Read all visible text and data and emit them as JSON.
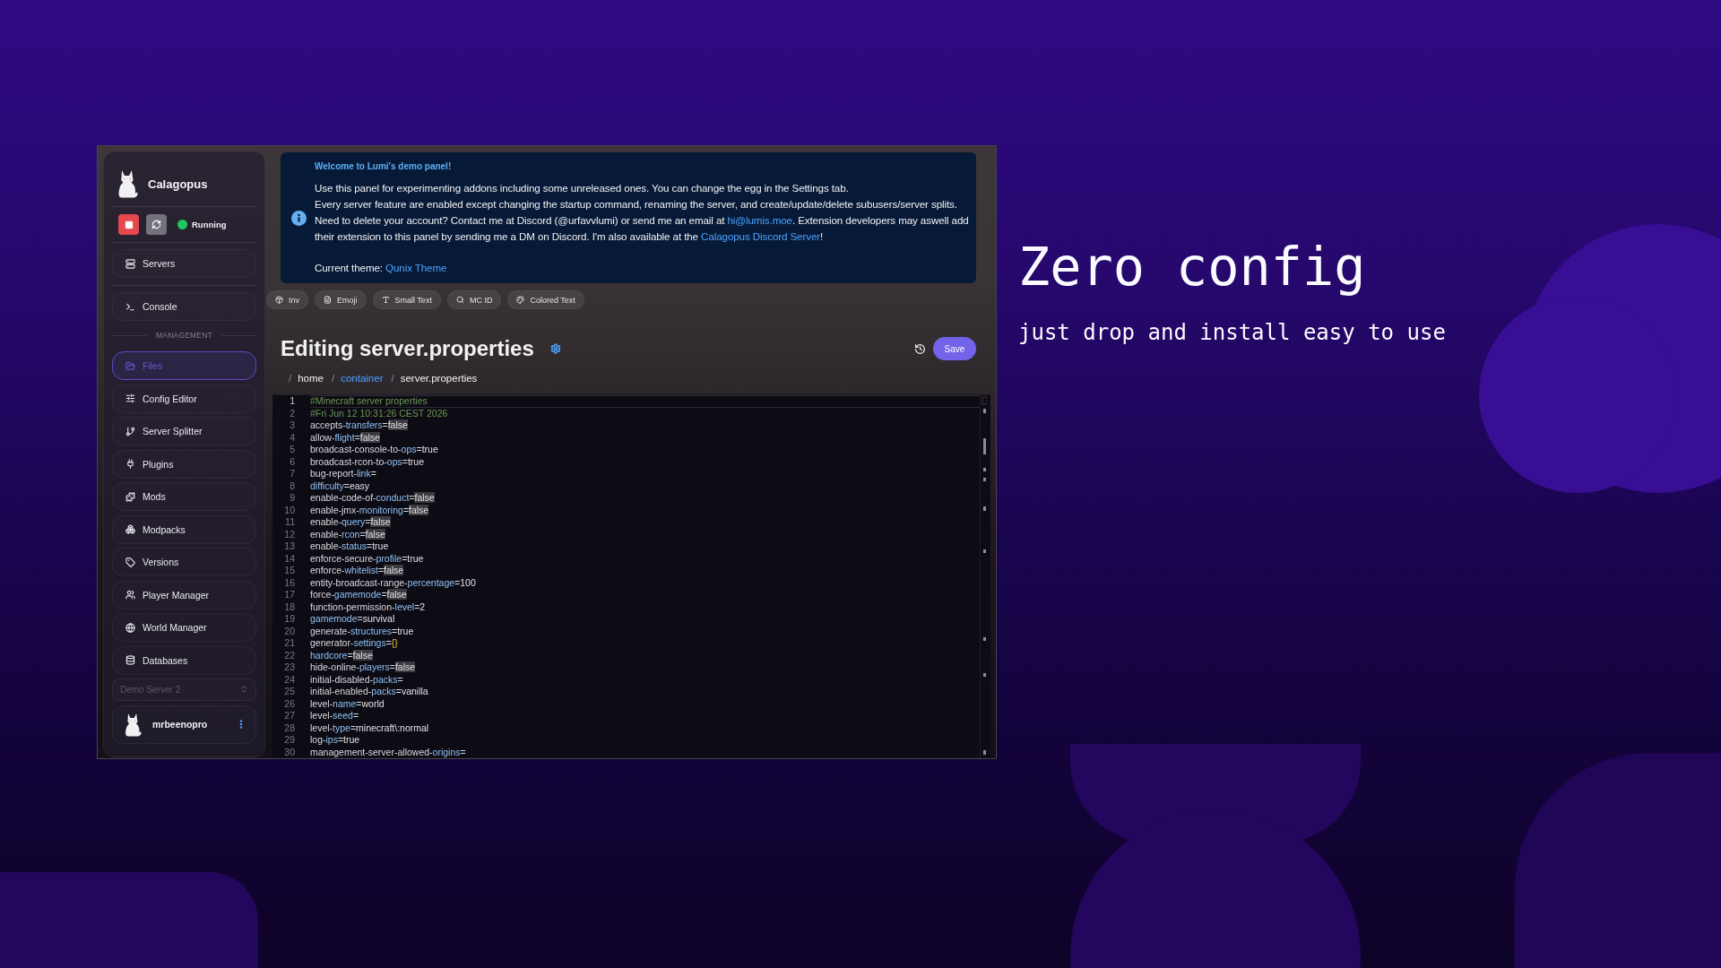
{
  "sidebar": {
    "brand": "Calagopus",
    "status": "Running",
    "nav_groups": [
      {
        "items": [
          {
            "label": "Servers",
            "selected": false
          }
        ]
      },
      {
        "items": [
          {
            "label": "Console",
            "selected": false
          }
        ]
      },
      {
        "heading": "MANAGEMENT",
        "items": [
          {
            "label": "Files",
            "selected": true
          },
          {
            "label": "Config Editor",
            "selected": false
          },
          {
            "label": "Server Splitter",
            "selected": false
          },
          {
            "label": "Plugins",
            "selected": false
          },
          {
            "label": "Mods",
            "selected": false
          },
          {
            "label": "Modpacks",
            "selected": false
          },
          {
            "label": "Versions",
            "selected": false
          },
          {
            "label": "Player Manager",
            "selected": false
          },
          {
            "label": "World Manager",
            "selected": false
          },
          {
            "label": "Databases",
            "selected": false
          }
        ]
      }
    ],
    "server_select": {
      "value": "Demo Server 2",
      "disabled": true
    },
    "user": {
      "name": "mrbeenopro"
    }
  },
  "notice": {
    "title": "Welcome to Lumi's demo panel!",
    "paragraphs": [
      {
        "segments": [
          {
            "kind": "text",
            "text": "Use this panel for experimenting addons including some unreleased ones. You can change the egg in the Settings tab."
          }
        ]
      },
      {
        "segments": [
          {
            "kind": "text",
            "text": "Every server feature are enabled except changing the startup command, renaming the server, and create/update/delete subusers/server splits."
          }
        ]
      },
      {
        "segments": [
          {
            "kind": "text",
            "text": "Need to delete your account? Contact me at Discord (@urfavvlumi) or send me an email at "
          },
          {
            "kind": "link",
            "text": "hi@lumis.moe"
          },
          {
            "kind": "text",
            "text": ". Extension developers may aswell add their extension to this panel by sending me a DM on Discord. I'm also available at the "
          },
          {
            "kind": "link",
            "text": "Calagopus Discord Server"
          },
          {
            "kind": "text",
            "text": "!"
          }
        ]
      }
    ],
    "theme_line": {
      "segments": [
        {
          "kind": "text",
          "text": "Current theme: "
        },
        {
          "kind": "link",
          "text": "Qunix Theme"
        }
      ]
    }
  },
  "toolbar": {
    "items": [
      {
        "label": "Inv"
      },
      {
        "label": "Emoji"
      },
      {
        "label": "Small Text"
      },
      {
        "label": "MC ID"
      },
      {
        "label": "Colored Text"
      }
    ]
  },
  "editor": {
    "title": "Editing server.properties",
    "save_label": "Save",
    "breadcrumb": [
      {
        "separator": "/",
        "label": "home",
        "link": false
      },
      {
        "separator": "/",
        "label": "container",
        "link": true
      },
      {
        "separator": "/",
        "label": "server.properties",
        "link": false
      }
    ],
    "lines": [
      {
        "number": "1",
        "kind": "comment",
        "text": "#Minecraft server properties",
        "highlighted": false,
        "active": true
      },
      {
        "number": "2",
        "kind": "comment",
        "text": "#Fri Jun 12 10:31:26 CEST 2026",
        "highlighted": false,
        "active": false
      },
      {
        "number": "3",
        "kind": "property",
        "key_head": "accepts-",
        "key_tail": "transfers",
        "operator": "=",
        "value": {
          "kind": "word",
          "text": "false"
        },
        "highlighted": true,
        "active": false
      },
      {
        "number": "4",
        "kind": "property",
        "key_head": "allow-",
        "key_tail": "flight",
        "operator": "=",
        "value": {
          "kind": "word",
          "text": "false"
        },
        "highlighted": true,
        "active": false
      },
      {
        "number": "5",
        "kind": "property",
        "key_head": "broadcast-console-to-",
        "key_tail": "ops",
        "operator": "=",
        "value": {
          "kind": "word",
          "text": "true"
        },
        "highlighted": false,
        "active": false
      },
      {
        "number": "6",
        "kind": "property",
        "key_head": "broadcast-rcon-to-",
        "key_tail": "ops",
        "operator": "=",
        "value": {
          "kind": "word",
          "text": "true"
        },
        "highlighted": false,
        "active": false
      },
      {
        "number": "7",
        "kind": "property",
        "key_head": "bug-report-",
        "key_tail": "link",
        "operator": "=",
        "highlighted": false,
        "active": false
      },
      {
        "number": "8",
        "kind": "property",
        "key_tail": "difficulty",
        "operator": "=",
        "value": {
          "kind": "word",
          "text": "easy"
        },
        "highlighted": false,
        "active": false
      },
      {
        "number": "9",
        "kind": "property",
        "key_head": "enable-code-of-",
        "key_tail": "conduct",
        "operator": "=",
        "value": {
          "kind": "word",
          "text": "false"
        },
        "highlighted": true,
        "active": false
      },
      {
        "number": "10",
        "kind": "property",
        "key_head": "enable-jmx-",
        "key_tail": "monitoring",
        "operator": "=",
        "value": {
          "kind": "word",
          "text": "false"
        },
        "highlighted": true,
        "active": false
      },
      {
        "number": "11",
        "kind": "property",
        "key_head": "enable-",
        "key_tail": "query",
        "operator": "=",
        "value": {
          "kind": "word",
          "text": "false"
        },
        "highlighted": true,
        "active": false
      },
      {
        "number": "12",
        "kind": "property",
        "key_head": "enable-",
        "key_tail": "rcon",
        "operator": "=",
        "value": {
          "kind": "word",
          "text": "false"
        },
        "highlighted": true,
        "active": false
      },
      {
        "number": "13",
        "kind": "property",
        "key_head": "enable-",
        "key_tail": "status",
        "operator": "=",
        "value": {
          "kind": "word",
          "text": "true"
        },
        "highlighted": false,
        "active": false
      },
      {
        "number": "14",
        "kind": "property",
        "key_head": "enforce-secure-",
        "key_tail": "profile",
        "operator": "=",
        "value": {
          "kind": "word",
          "text": "true"
        },
        "highlighted": false,
        "active": false
      },
      {
        "number": "15",
        "kind": "property",
        "key_head": "enforce-",
        "key_tail": "whitelist",
        "operator": "=",
        "value": {
          "kind": "word",
          "text": "false"
        },
        "highlighted": true,
        "active": false
      },
      {
        "number": "16",
        "kind": "property",
        "key_head": "entity-broadcast-range-",
        "key_tail": "percentage",
        "operator": "=",
        "value": {
          "kind": "word",
          "text": "100"
        },
        "highlighted": false,
        "active": false
      },
      {
        "number": "17",
        "kind": "property",
        "key_head": "force-",
        "key_tail": "gamemode",
        "operator": "=",
        "value": {
          "kind": "word",
          "text": "false"
        },
        "highlighted": true,
        "active": false
      },
      {
        "number": "18",
        "kind": "property",
        "key_head": "function-permission-",
        "key_tail": "level",
        "operator": "=",
        "value": {
          "kind": "word",
          "text": "2"
        },
        "highlighted": false,
        "active": false
      },
      {
        "number": "19",
        "kind": "property",
        "key_tail": "gamemode",
        "operator": "=",
        "value": {
          "kind": "word",
          "text": "survival"
        },
        "highlighted": false,
        "active": false
      },
      {
        "number": "20",
        "kind": "property",
        "key_head": "generate-",
        "key_tail": "structures",
        "operator": "=",
        "value": {
          "kind": "word",
          "text": "true"
        },
        "highlighted": false,
        "active": false
      },
      {
        "number": "21",
        "kind": "property",
        "key_head": "generator-",
        "key_tail": "settings",
        "operator": "=",
        "value": {
          "kind": "brace",
          "text": "{}"
        },
        "highlighted": false,
        "active": false
      },
      {
        "number": "22",
        "kind": "property",
        "key_tail": "hardcore",
        "operator": "=",
        "value": {
          "kind": "word",
          "text": "false"
        },
        "highlighted": true,
        "active": false
      },
      {
        "number": "23",
        "kind": "property",
        "key_head": "hide-online-",
        "key_tail": "players",
        "operator": "=",
        "value": {
          "kind": "word",
          "text": "false"
        },
        "highlighted": true,
        "active": false
      },
      {
        "number": "24",
        "kind": "property",
        "key_head": "initial-disabled-",
        "key_tail": "packs",
        "operator": "=",
        "highlighted": false,
        "active": false
      },
      {
        "number": "25",
        "kind": "property",
        "key_head": "initial-enabled-",
        "key_tail": "packs",
        "operator": "=",
        "value": {
          "kind": "word",
          "text": "vanilla"
        },
        "highlighted": false,
        "active": false
      },
      {
        "number": "26",
        "kind": "property",
        "key_head": "level-",
        "key_tail": "name",
        "operator": "=",
        "value": {
          "kind": "word",
          "text": "world"
        },
        "highlighted": false,
        "active": false
      },
      {
        "number": "27",
        "kind": "property",
        "key_head": "level-",
        "key_tail": "seed",
        "operator": "=",
        "highlighted": false,
        "active": false
      },
      {
        "number": "28",
        "kind": "property",
        "key_head": "level-",
        "key_tail": "type",
        "operator": "=",
        "value": {
          "kind": "word",
          "text": "minecraft\\:normal"
        },
        "highlighted": false,
        "active": false
      },
      {
        "number": "29",
        "kind": "property",
        "key_head": "log-",
        "key_tail": "ips",
        "operator": "=",
        "value": {
          "kind": "word",
          "text": "true"
        },
        "highlighted": false,
        "active": false
      },
      {
        "number": "30",
        "kind": "property",
        "key_head": "management-server-allowed-",
        "key_tail": "origins",
        "operator": "=",
        "highlighted": false,
        "active": false
      }
    ]
  },
  "promo": {
    "heading": "Zero config",
    "subheading": "just drop and install easy to use"
  }
}
